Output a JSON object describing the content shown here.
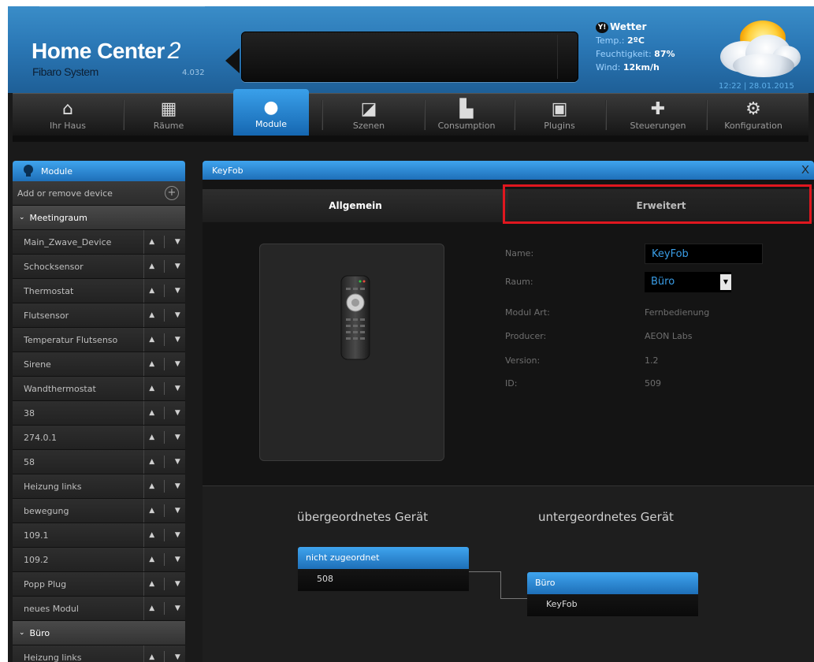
{
  "header": {
    "brand": "Home Center",
    "brand_number": "2",
    "subtitle": "Fibaro System",
    "version": "4.032"
  },
  "weather": {
    "title": "Wetter",
    "temp_label": "Temp.:",
    "temp_value": "2ºC",
    "humidity_label": "Feuchtigkeit:",
    "humidity_value": "87%",
    "wind_label": "Wind:",
    "wind_value": "12km/h",
    "datetime": "12:22 | 28.01.2015"
  },
  "nav": [
    {
      "label": "Ihr Haus",
      "icon": "house-icon"
    },
    {
      "label": "Räume",
      "icon": "rooms-icon"
    },
    {
      "label": "Module",
      "icon": "bulb-icon"
    },
    {
      "label": "Szenen",
      "icon": "clapper-icon"
    },
    {
      "label": "Consumption",
      "icon": "chart-icon"
    },
    {
      "label": "Plugins",
      "icon": "plugin-icon"
    },
    {
      "label": "Steuerungen",
      "icon": "puzzle-icon"
    },
    {
      "label": "Konfiguration",
      "icon": "gear-icon"
    }
  ],
  "sidebar": {
    "title": "Module",
    "add_label": "Add or remove device",
    "groups": [
      {
        "name": "Meetingraum",
        "devices": [
          "Main_Zwave_Device",
          "Schocksensor",
          "Thermostat",
          "Flutsensor",
          "Temperatur Flutsenso",
          "Sirene",
          "Wandthermostat",
          "38",
          "274.0.1",
          "58",
          "Heizung links",
          "bewegung",
          "109.1",
          "109.2",
          "Popp Plug",
          "neues Modul"
        ]
      },
      {
        "name": "Büro",
        "devices": [
          "Heizung links"
        ]
      }
    ]
  },
  "panel": {
    "title": "KeyFob",
    "tabs": [
      "Allgemein",
      "Erweitert"
    ],
    "fields": {
      "name_label": "Name:",
      "name_value": "KeyFob",
      "room_label": "Raum:",
      "room_value": "Büro",
      "type_label": "Modul Art:",
      "type_value": "Fernbedienung",
      "producer_label": "Producer:",
      "producer_value": "AEON Labs",
      "version_label": "Version:",
      "version_value": "1.2",
      "id_label": "ID:",
      "id_value": "509"
    },
    "parent": {
      "title": "übergeordnetes Gerät",
      "head": "nicht zugeordnet",
      "item": "508"
    },
    "child": {
      "title": "untergeordnetes Gerät",
      "head": "Büro",
      "item": "KeyFob"
    }
  },
  "colors": {
    "accent": "#2a8ad8",
    "highlight": "#e0171f",
    "link": "#3a9de6"
  }
}
